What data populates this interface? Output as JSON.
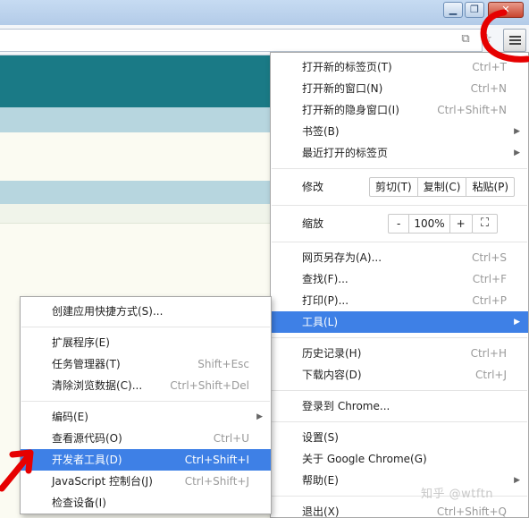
{
  "window": {
    "minimize_label": "▁",
    "restore_label": "❐",
    "close_label": "✕"
  },
  "toolbar": {
    "icons": [
      "translate-icon",
      "bookmark-star-icon",
      "hamburger-menu-icon"
    ]
  },
  "main_menu": {
    "items": [
      {
        "label": "打开新的标签页(T)",
        "shortcut": "Ctrl+T"
      },
      {
        "label": "打开新的窗口(N)",
        "shortcut": "Ctrl+N"
      },
      {
        "label": "打开新的隐身窗口(I)",
        "shortcut": "Ctrl+Shift+N"
      },
      {
        "label": "书签(B)",
        "submenu": true
      },
      {
        "label": "最近打开的标签页",
        "submenu": true
      }
    ],
    "edit": {
      "label": "修改",
      "cut": "剪切(T)",
      "copy": "复制(C)",
      "paste": "粘贴(P)"
    },
    "zoom": {
      "label": "缩放",
      "minus": "-",
      "value": "100%",
      "plus": "+",
      "fullscreen": "⛶"
    },
    "items2": [
      {
        "label": "网页另存为(A)...",
        "shortcut": "Ctrl+S"
      },
      {
        "label": "查找(F)...",
        "shortcut": "Ctrl+F"
      },
      {
        "label": "打印(P)...",
        "shortcut": "Ctrl+P"
      },
      {
        "label": "工具(L)",
        "submenu": true,
        "highlighted": true
      }
    ],
    "items3": [
      {
        "label": "历史记录(H)",
        "shortcut": "Ctrl+H"
      },
      {
        "label": "下载内容(D)",
        "shortcut": "Ctrl+J"
      }
    ],
    "signin": {
      "label": "登录到 Chrome..."
    },
    "items4": [
      {
        "label": "设置(S)"
      },
      {
        "label": "关于 Google Chrome(G)"
      },
      {
        "label": "帮助(E)",
        "submenu": true
      }
    ],
    "exit": {
      "label": "退出(X)",
      "shortcut": "Ctrl+Shift+Q"
    }
  },
  "tools_menu": {
    "items": [
      {
        "label": "创建应用快捷方式(S)..."
      },
      {
        "label": "扩展程序(E)"
      },
      {
        "label": "任务管理器(T)",
        "shortcut": "Shift+Esc"
      },
      {
        "label": "清除浏览数据(C)...",
        "shortcut": "Ctrl+Shift+Del"
      },
      {
        "label": "编码(E)",
        "submenu": true
      },
      {
        "label": "查看源代码(O)",
        "shortcut": "Ctrl+U"
      },
      {
        "label": "开发者工具(D)",
        "shortcut": "Ctrl+Shift+I",
        "highlighted": true
      },
      {
        "label": "JavaScript 控制台(J)",
        "shortcut": "Ctrl+Shift+J"
      },
      {
        "label": "检查设备(I)"
      }
    ]
  },
  "watermark": "知乎 @wtftn",
  "colors": {
    "highlight": "#3e80e6",
    "annotation": "#e60000",
    "page_header": "#1a7a86"
  }
}
